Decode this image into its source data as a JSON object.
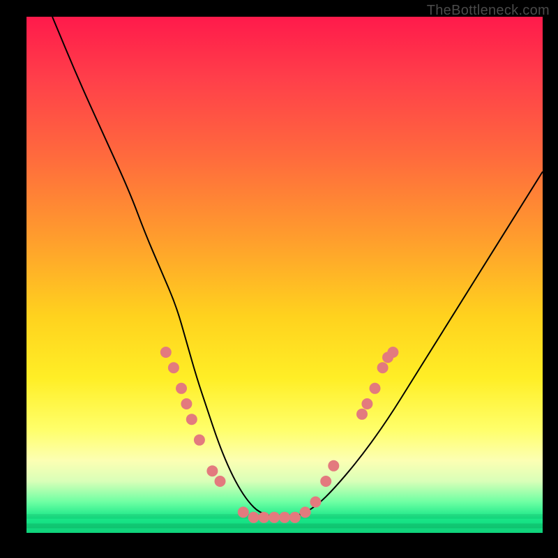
{
  "watermark": "TheBottleneck.com",
  "chart_data": {
    "type": "line",
    "title": "",
    "xlabel": "",
    "ylabel": "",
    "xlim": [
      0,
      100
    ],
    "ylim": [
      0,
      100
    ],
    "grid": false,
    "legend": false,
    "series": [
      {
        "name": "bottleneck-curve",
        "color": "#000000",
        "x": [
          5,
          10,
          15,
          20,
          23,
          26,
          29,
          31,
          33,
          35,
          37,
          39,
          41,
          43,
          45,
          48,
          52,
          56,
          60,
          65,
          70,
          75,
          80,
          85,
          90,
          95,
          100
        ],
        "y": [
          100,
          88,
          77,
          66,
          58,
          51,
          44,
          37,
          30,
          24,
          18,
          13,
          9,
          6,
          4,
          3,
          3,
          5,
          9,
          15,
          22,
          30,
          38,
          46,
          54,
          62,
          70
        ]
      }
    ],
    "markers": {
      "name": "highlight-points",
      "color": "#e37a7e",
      "radius": 8,
      "points": [
        {
          "x": 27,
          "y": 35
        },
        {
          "x": 28.5,
          "y": 32
        },
        {
          "x": 30,
          "y": 28
        },
        {
          "x": 31,
          "y": 25
        },
        {
          "x": 32,
          "y": 22
        },
        {
          "x": 33.5,
          "y": 18
        },
        {
          "x": 36,
          "y": 12
        },
        {
          "x": 37.5,
          "y": 10
        },
        {
          "x": 42,
          "y": 4
        },
        {
          "x": 44,
          "y": 3
        },
        {
          "x": 46,
          "y": 3
        },
        {
          "x": 48,
          "y": 3
        },
        {
          "x": 50,
          "y": 3
        },
        {
          "x": 52,
          "y": 3
        },
        {
          "x": 54,
          "y": 4
        },
        {
          "x": 56,
          "y": 6
        },
        {
          "x": 58,
          "y": 10
        },
        {
          "x": 59.5,
          "y": 13
        },
        {
          "x": 65,
          "y": 23
        },
        {
          "x": 66,
          "y": 25
        },
        {
          "x": 67.5,
          "y": 28
        },
        {
          "x": 69,
          "y": 32
        },
        {
          "x": 70,
          "y": 34
        },
        {
          "x": 71,
          "y": 35
        }
      ]
    }
  }
}
